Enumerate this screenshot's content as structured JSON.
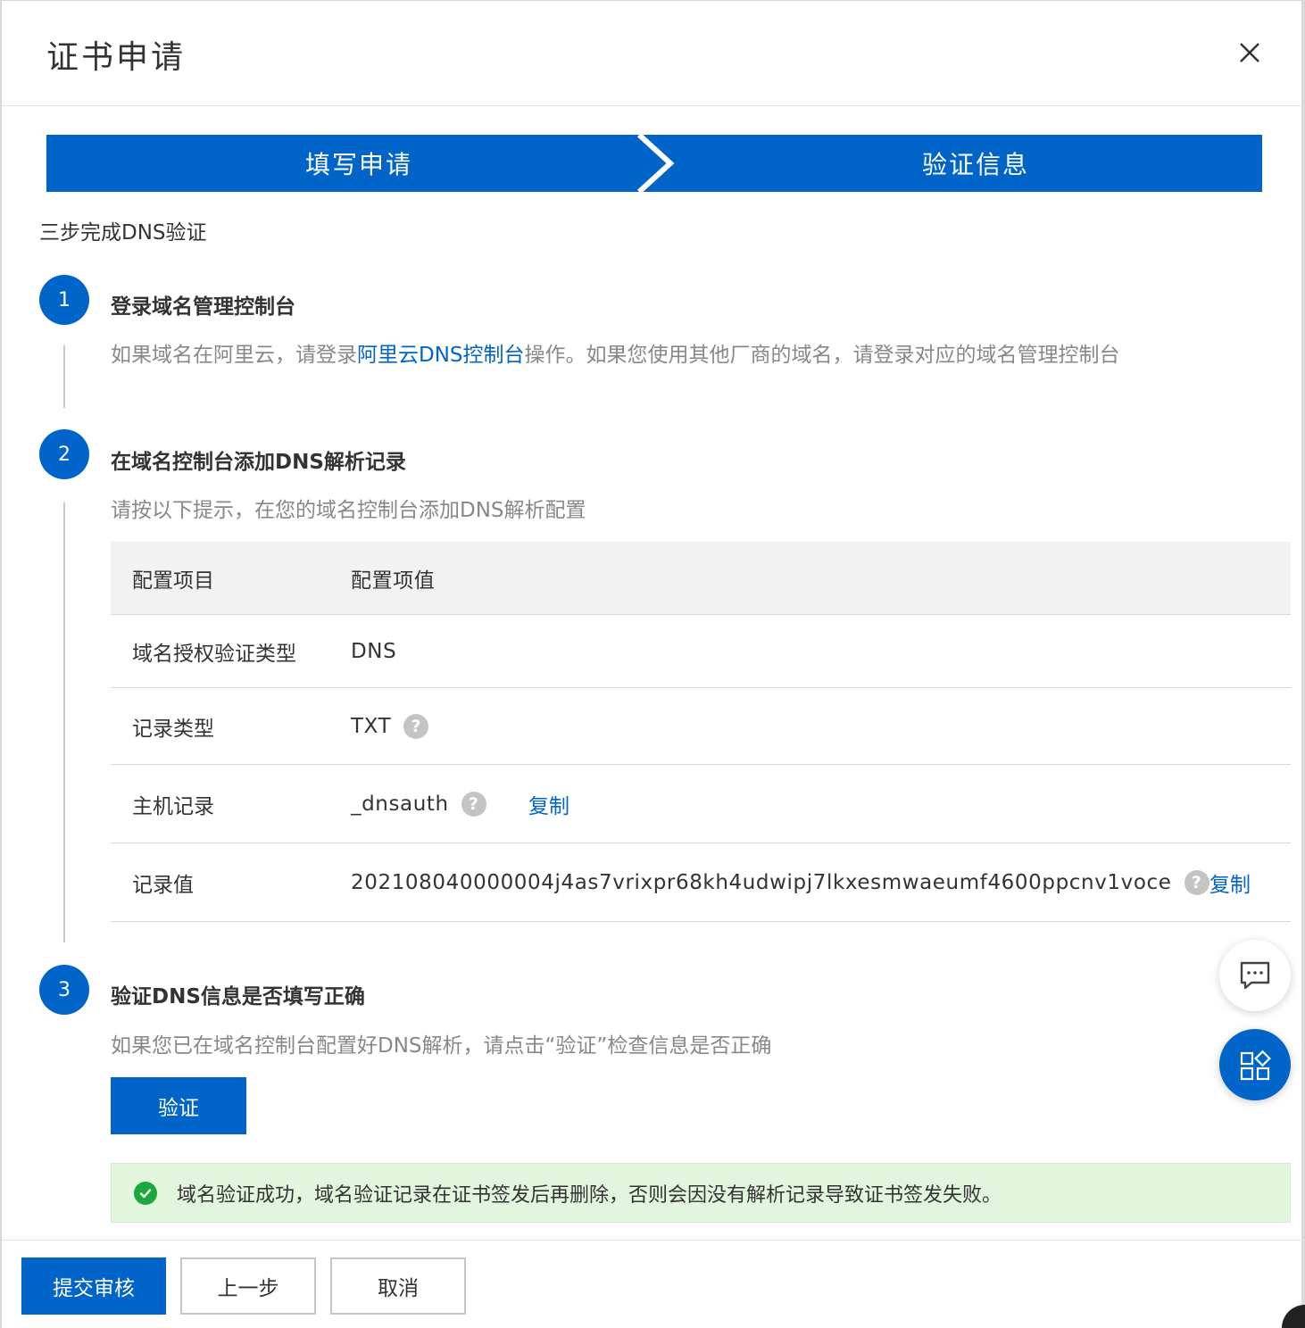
{
  "dialog": {
    "title": "证书申请"
  },
  "steps": [
    {
      "label": "填写申请"
    },
    {
      "label": "验证信息"
    }
  ],
  "intro": "三步完成DNS验证",
  "sections": [
    {
      "number": "1",
      "title": "登录域名管理控制台",
      "desc_before": "如果域名在阿里云，请登录",
      "desc_link": "阿里云DNS控制台",
      "desc_after": "操作。如果您使用其他厂商的域名，请登录对应的域名管理控制台"
    },
    {
      "number": "2",
      "title": "在域名控制台添加DNS解析记录",
      "desc": "请按以下提示，在您的域名控制台添加DNS解析配置"
    },
    {
      "number": "3",
      "title": "验证DNS信息是否填写正确",
      "desc": "如果您已在域名控制台配置好DNS解析，请点击“验证”检查信息是否正确"
    }
  ],
  "table": {
    "headers": [
      "配置项目",
      "配置项值"
    ],
    "rows": [
      {
        "key": "域名授权验证类型",
        "value": "DNS"
      },
      {
        "key": "记录类型",
        "value": "TXT"
      },
      {
        "key": "主机记录",
        "value": "_dnsauth",
        "copy": "复制"
      },
      {
        "key": "记录值",
        "value": "202108040000004j4as7vrixpr68kh4udwipj7lkxesmwaeumf4600ppcnv1voce",
        "copy": "复制"
      }
    ]
  },
  "help_mark": "?",
  "verify_button": "验证",
  "success_message": "域名验证成功，域名验证记录在证书签发后再删除，否则会因没有解析记录导致证书签发失败。",
  "footer": {
    "submit": "提交审核",
    "prev": "上一步",
    "cancel": "取消"
  },
  "colors": {
    "primary": "#0064c8",
    "success_bg": "#e2f5dd",
    "success_icon": "#1aa83b",
    "muted_text": "#888888"
  },
  "icons": {
    "close": "close-icon",
    "help": "question-icon",
    "success": "check-circle-icon",
    "chat": "chat-icon",
    "apps": "apps-icon"
  }
}
